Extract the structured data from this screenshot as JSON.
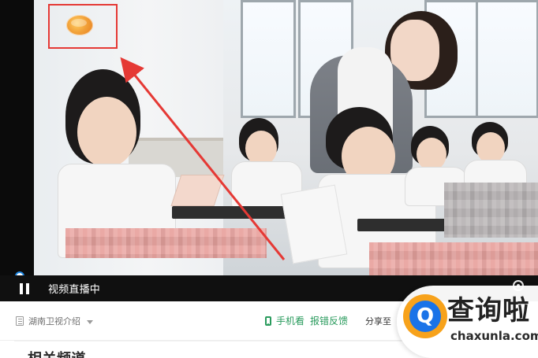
{
  "player": {
    "status_text": "视频直播中"
  },
  "info_bar": {
    "channel_label": "湖南卫视介绍",
    "action_mobile": "手机看",
    "action_report": "报错反馈",
    "share_label": "分享至"
  },
  "section": {
    "title": "相关频道"
  },
  "watermark": {
    "title": "查询啦",
    "domain": "chaxunla.com",
    "accent_orange": "#f7a21b",
    "accent_blue": "#1a73e8"
  },
  "colors": {
    "highlight_red": "#e53935",
    "action_green": "#2a9b5d",
    "controls_bg": "#101010"
  },
  "icons": {
    "pause": "pause-icon",
    "phone": "phone-icon",
    "doc": "doc-icon",
    "dropdown": "chevron-down-icon",
    "settings": "gear-icon",
    "logo": "hunan-tv-logo"
  }
}
